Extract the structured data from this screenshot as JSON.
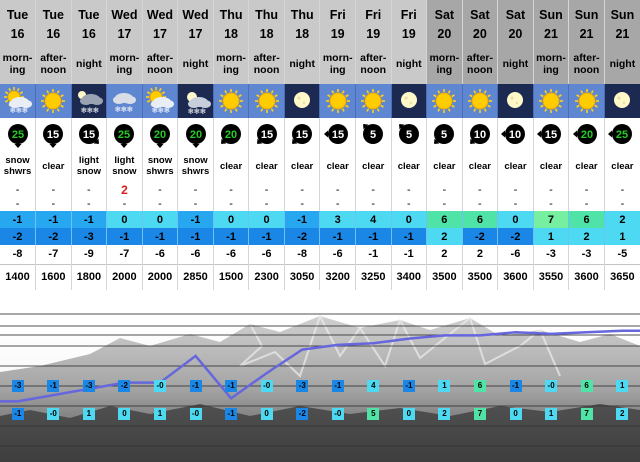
{
  "columns": [
    {
      "day": "Tue",
      "date": "16",
      "tod": [
        "morn-",
        "ing"
      ],
      "icon": "snow-showers-sun-icon",
      "tone": "weekday",
      "wind": 25,
      "wind_dir": "S",
      "wind_color": "#22cc22",
      "summary": [
        "snow",
        "shwrs"
      ],
      "snow": "-",
      "rain": "-",
      "tmax": "-1",
      "tmin": "-2",
      "tmax_color": "#27a7f0",
      "tmin_color": "#1a86e6",
      "chill": "-8",
      "freezing": "1400",
      "sky": "day"
    },
    {
      "day": "Tue",
      "date": "16",
      "tod": [
        "after-",
        "noon"
      ],
      "icon": "sun-icon",
      "tone": "weekday",
      "wind": 15,
      "wind_dir": "S",
      "wind_color": "#000000",
      "summary": [
        "clear"
      ],
      "snow": "-",
      "rain": "-",
      "tmax": "-1",
      "tmin": "-2",
      "tmax_color": "#27a7f0",
      "tmin_color": "#1a86e6",
      "chill": "-7",
      "freezing": "1600",
      "sky": "day"
    },
    {
      "day": "Tue",
      "date": "16",
      "tod": [
        "night"
      ],
      "icon": "snow-night-cloud-icon",
      "tone": "weekday",
      "wind": 15,
      "wind_dir": "SE",
      "wind_color": "#000000",
      "summary": [
        "light",
        "snow"
      ],
      "snow": "-",
      "rain": "-",
      "tmax": "-1",
      "tmin": "-3",
      "tmax_color": "#27a7f0",
      "tmin_color": "#1a86e6",
      "chill": "-9",
      "freezing": "1800",
      "sky": "night"
    },
    {
      "day": "Wed",
      "date": "17",
      "tod": [
        "morn-",
        "ing"
      ],
      "icon": "snow-cloud-icon",
      "tone": "weekday",
      "wind": 25,
      "wind_dir": "S",
      "wind_color": "#22cc22",
      "summary": [
        "light",
        "snow"
      ],
      "snow": "2",
      "rain": "-",
      "tmax": "0",
      "tmin": "-1",
      "tmax_color": "#4dd9f2",
      "tmin_color": "#1a86e6",
      "chill": "-7",
      "freezing": "2000",
      "sky": "day"
    },
    {
      "day": "Wed",
      "date": "17",
      "tod": [
        "after-",
        "noon"
      ],
      "icon": "snow-showers-sun-icon",
      "tone": "weekday",
      "wind": 20,
      "wind_dir": "S",
      "wind_color": "#22cc22",
      "summary": [
        "snow",
        "shwrs"
      ],
      "snow": "-",
      "rain": "-",
      "tmax": "0",
      "tmin": "-1",
      "tmax_color": "#4dd9f2",
      "tmin_color": "#1a86e6",
      "chill": "-6",
      "freezing": "2000",
      "sky": "day"
    },
    {
      "day": "Wed",
      "date": "17",
      "tod": [
        "night"
      ],
      "icon": "snow-night-icon",
      "tone": "weekday",
      "wind": 20,
      "wind_dir": "S",
      "wind_color": "#22cc22",
      "summary": [
        "snow",
        "shwrs"
      ],
      "snow": "-",
      "rain": "-",
      "tmax": "-1",
      "tmin": "-1",
      "tmax_color": "#27a7f0",
      "tmin_color": "#1a86e6",
      "chill": "-6",
      "freezing": "2850",
      "sky": "night"
    },
    {
      "day": "Thu",
      "date": "18",
      "tod": [
        "morn-",
        "ing"
      ],
      "icon": "sun-icon",
      "tone": "weekday",
      "wind": 20,
      "wind_dir": "SW",
      "wind_color": "#22cc22",
      "summary": [
        "clear"
      ],
      "snow": "-",
      "rain": "-",
      "tmax": "0",
      "tmin": "-1",
      "tmax_color": "#4dd9f2",
      "tmin_color": "#1a86e6",
      "chill": "-6",
      "freezing": "1500",
      "sky": "day"
    },
    {
      "day": "Thu",
      "date": "18",
      "tod": [
        "after-",
        "noon"
      ],
      "icon": "sun-icon",
      "tone": "weekday",
      "wind": 15,
      "wind_dir": "SW",
      "wind_color": "#000000",
      "summary": [
        "clear"
      ],
      "snow": "-",
      "rain": "-",
      "tmax": "0",
      "tmin": "-1",
      "tmax_color": "#4dd9f2",
      "tmin_color": "#1a86e6",
      "chill": "-6",
      "freezing": "2300",
      "sky": "day"
    },
    {
      "day": "Thu",
      "date": "18",
      "tod": [
        "night"
      ],
      "icon": "moon-icon",
      "tone": "weekday",
      "wind": 15,
      "wind_dir": "SW",
      "wind_color": "#000000",
      "summary": [
        "clear"
      ],
      "snow": "-",
      "rain": "-",
      "tmax": "-1",
      "tmin": "-2",
      "tmax_color": "#27a7f0",
      "tmin_color": "#1a86e6",
      "chill": "-8",
      "freezing": "3050",
      "sky": "night"
    },
    {
      "day": "Fri",
      "date": "19",
      "tod": [
        "morn-",
        "ing"
      ],
      "icon": "sun-icon",
      "tone": "weekday",
      "wind": 15,
      "wind_dir": "W",
      "wind_color": "#000000",
      "summary": [
        "clear"
      ],
      "snow": "-",
      "rain": "-",
      "tmax": "3",
      "tmin": "-1",
      "tmax_color": "#4dd9f2",
      "tmin_color": "#1a86e6",
      "chill": "-6",
      "freezing": "3200",
      "sky": "day"
    },
    {
      "day": "Fri",
      "date": "19",
      "tod": [
        "after-",
        "noon"
      ],
      "icon": "sun-icon",
      "tone": "weekday",
      "wind": 5,
      "wind_dir": "NW",
      "wind_color": "#000000",
      "summary": [
        "clear"
      ],
      "snow": "-",
      "rain": "-",
      "tmax": "4",
      "tmin": "-1",
      "tmax_color": "#4dd9f2",
      "tmin_color": "#1a86e6",
      "chill": "-1",
      "freezing": "3250",
      "sky": "day"
    },
    {
      "day": "Fri",
      "date": "19",
      "tod": [
        "night"
      ],
      "icon": "moon-icon",
      "tone": "weekday",
      "wind": 5,
      "wind_dir": "NW",
      "wind_color": "#000000",
      "summary": [
        "clear"
      ],
      "snow": "-",
      "rain": "-",
      "tmax": "0",
      "tmin": "-1",
      "tmax_color": "#4dd9f2",
      "tmin_color": "#1a86e6",
      "chill": "-1",
      "freezing": "3400",
      "sky": "night"
    },
    {
      "day": "Sat",
      "date": "20",
      "tod": [
        "morn-",
        "ing"
      ],
      "icon": "sun-icon",
      "tone": "weekend",
      "wind": 5,
      "wind_dir": "SW",
      "wind_color": "#000000",
      "summary": [
        "clear"
      ],
      "snow": "-",
      "rain": "-",
      "tmax": "6",
      "tmin": "2",
      "tmax_color": "#4fe3a8",
      "tmin_color": "#4dd9f2",
      "chill": "2",
      "freezing": "3500",
      "sky": "day"
    },
    {
      "day": "Sat",
      "date": "20",
      "tod": [
        "after-",
        "noon"
      ],
      "icon": "sun-icon",
      "tone": "weekend",
      "wind": 10,
      "wind_dir": "SW",
      "wind_color": "#000000",
      "summary": [
        "clear"
      ],
      "snow": "-",
      "rain": "-",
      "tmax": "6",
      "tmin": "-2",
      "tmax_color": "#4fe3a8",
      "tmin_color": "#1a86e6",
      "chill": "2",
      "freezing": "3500",
      "sky": "day"
    },
    {
      "day": "Sat",
      "date": "20",
      "tod": [
        "night"
      ],
      "icon": "moon-icon",
      "tone": "weekend",
      "wind": 10,
      "wind_dir": "W",
      "wind_color": "#000000",
      "summary": [
        "clear"
      ],
      "snow": "-",
      "rain": "-",
      "tmax": "0",
      "tmin": "-2",
      "tmax_color": "#4dd9f2",
      "tmin_color": "#1a86e6",
      "chill": "-6",
      "freezing": "3600",
      "sky": "night"
    },
    {
      "day": "Sun",
      "date": "21",
      "tod": [
        "morn-",
        "ing"
      ],
      "icon": "sun-icon",
      "tone": "weekend",
      "wind": 15,
      "wind_dir": "W",
      "wind_color": "#000000",
      "summary": [
        "clear"
      ],
      "snow": "-",
      "rain": "-",
      "tmax": "7",
      "tmin": "1",
      "tmax_color": "#76f0a0",
      "tmin_color": "#4dd9f2",
      "chill": "-3",
      "freezing": "3550",
      "sky": "day"
    },
    {
      "day": "Sun",
      "date": "21",
      "tod": [
        "after-",
        "noon"
      ],
      "icon": "sun-icon",
      "tone": "weekend",
      "wind": 20,
      "wind_dir": "W",
      "wind_color": "#22cc22",
      "summary": [
        "clear"
      ],
      "snow": "-",
      "rain": "-",
      "tmax": "6",
      "tmin": "2",
      "tmax_color": "#4fe3a8",
      "tmin_color": "#4dd9f2",
      "chill": "-3",
      "freezing": "3600",
      "sky": "day"
    },
    {
      "day": "Sun",
      "date": "21",
      "tod": [
        "night"
      ],
      "icon": "moon-icon",
      "tone": "weekend",
      "wind": 25,
      "wind_dir": "W",
      "wind_color": "#22cc22",
      "summary": [
        "clear"
      ],
      "snow": "-",
      "rain": "-",
      "tmax": "2",
      "tmin": "1",
      "tmax_color": "#4dd9f2",
      "tmin_color": "#4dd9f2",
      "chill": "-5",
      "freezing": "3650",
      "sky": "night"
    }
  ],
  "chart": {
    "upper_markers": [
      "-3",
      "-1",
      "-3",
      "-2",
      "-0",
      "-1",
      "-1",
      "-0",
      "-3",
      "-1",
      "4",
      "-1",
      "1",
      "6",
      "-1",
      "-0",
      "6",
      "1"
    ],
    "lower_markers": [
      "-1",
      "-0",
      "1",
      "0",
      "1",
      "-0",
      "-1",
      "0",
      "-2",
      "-0",
      "5",
      "0",
      "2",
      "7",
      "0",
      "1",
      "7",
      "2"
    ],
    "freezing_level_line_color": "#6666dd",
    "colors": {
      "weekday_header": "#c9c9c9",
      "weekend_header": "#a7a7a7",
      "sky_day": "#5f86d1",
      "sky_night": "#1c2a52"
    }
  }
}
